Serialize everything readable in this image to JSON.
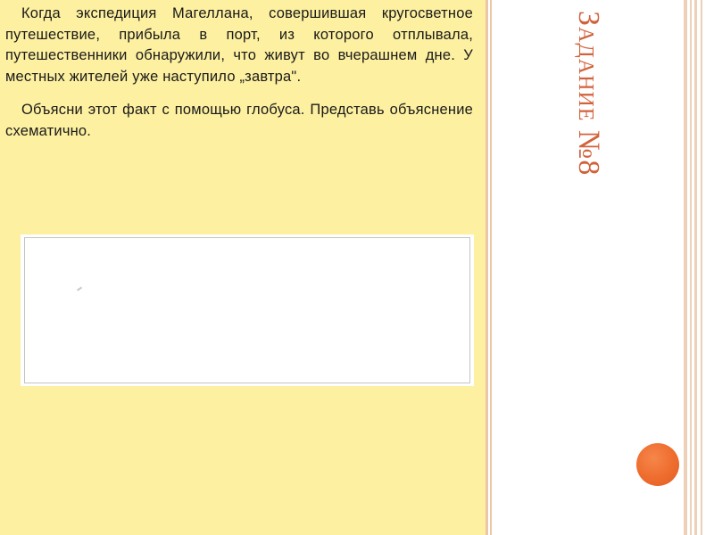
{
  "slide": {
    "title": "Задание №8",
    "paragraphs": [
      "Когда экспедиция Магеллана, совершившая кругосветное путешествие, прибыла в порт, из которого отплывала, путешественники обнаружили, что живут во вчерашнем дне. У местных жителей уже наступило „завтра\".",
      "Объясни этот факт с помощью глобуса. Представь объяснение схематично."
    ]
  },
  "colors": {
    "content_panel": "#fdf0a0",
    "title": "#d2623c",
    "accent_dot": "#ee6c2d",
    "stripes": "#ecc7a7"
  }
}
